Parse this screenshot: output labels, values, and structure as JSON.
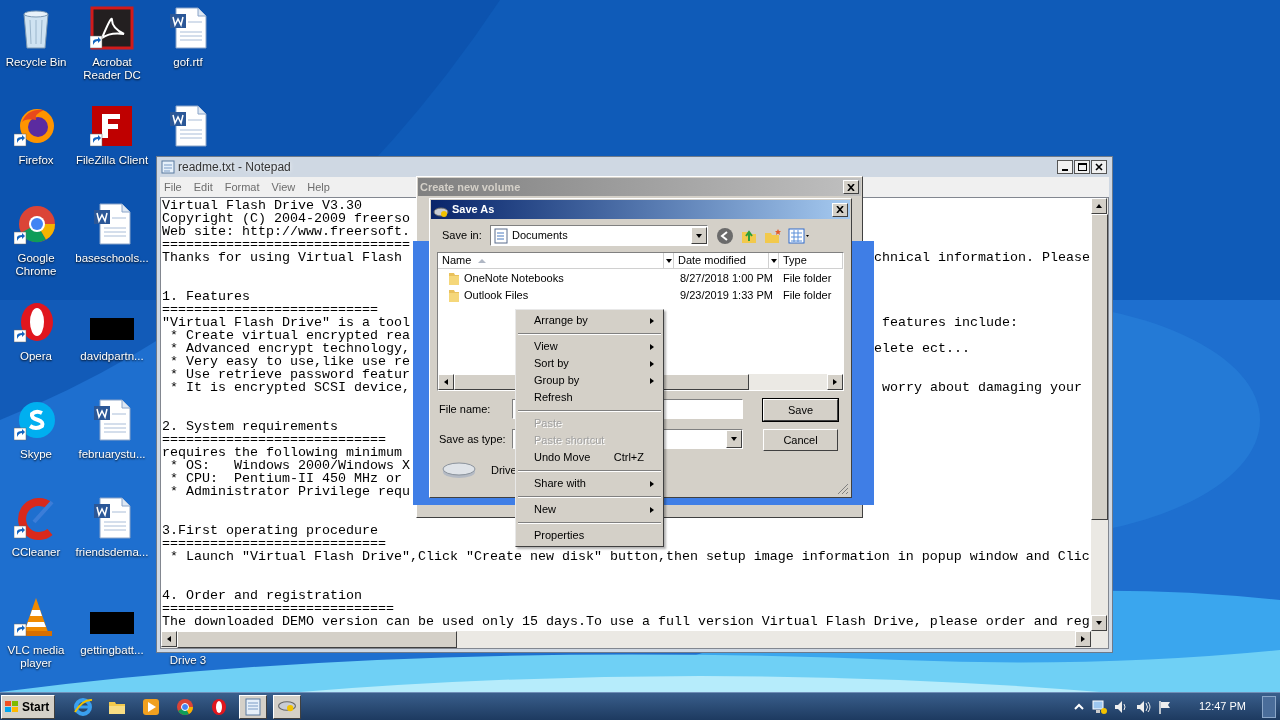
{
  "desktop_icons": [
    {
      "kind": "recycle",
      "label": "Recycle Bin"
    },
    {
      "kind": "firefox",
      "label": "Firefox"
    },
    {
      "kind": "chrome",
      "label": "Google Chrome"
    },
    {
      "kind": "opera",
      "label": "Opera"
    },
    {
      "kind": "skype",
      "label": "Skype"
    },
    {
      "kind": "ccleaner",
      "label": "CCleaner"
    },
    {
      "kind": "vlc",
      "label": "VLC media player"
    },
    {
      "kind": "acrobat",
      "label": "Acrobat Reader DC"
    },
    {
      "kind": "filezilla",
      "label": "FileZilla Client"
    },
    {
      "kind": "word",
      "label": "baseschools..."
    },
    {
      "kind": "redacted",
      "label": "davidpartn..."
    },
    {
      "kind": "word",
      "label": "februarystu..."
    },
    {
      "kind": "word",
      "label": "friendsdema..."
    },
    {
      "kind": "redacted",
      "label": "gettingbatt..."
    },
    {
      "kind": "word",
      "label": "gof.rtf"
    },
    {
      "kind": "word"
    },
    {
      "kind": "blank"
    },
    {
      "kind": "blank"
    },
    {
      "kind": "blank"
    },
    {
      "kind": "blank"
    },
    {
      "kind": "covered",
      "label": "Drive 3"
    }
  ],
  "notepad": {
    "title": "readme.txt - Notepad",
    "menu": [
      "File",
      "Edit",
      "Format",
      "View",
      "Help"
    ],
    "blocks": [
      [
        {
          "left": "Virtual Flash Drive V3.30"
        },
        {
          "left": "Copyright (C) 2004-2009 freerso"
        },
        {
          "left": "Web site: http://www.freersoft."
        },
        {
          "left": "==============================="
        },
        {
          "left": "Thanks for using Virtual Flash",
          "right": "chnical information. Please"
        }
      ],
      [
        {
          "left": "1. Features"
        },
        {
          "left": "==========================="
        },
        {
          "left": "\"Virtual Flash Drive\" is a tool",
          "right": " features include:"
        },
        {
          "left": " * Create virtual encrypted rea"
        },
        {
          "left": " * Advanced encrypt technology,",
          "right": "elete ect..."
        },
        {
          "left": " * Very easy to use,like use re"
        },
        {
          "left": " * Use retrieve password featur"
        },
        {
          "left": " * It is encrypted SCSI device,",
          "right": " worry about damaging your"
        }
      ],
      [
        {
          "left": "2. System requirements"
        },
        {
          "left": "============================"
        },
        {
          "left": "requires the following minimum"
        },
        {
          "left": " * OS:   Windows 2000/Windows X"
        },
        {
          "left": " * CPU:  Pentium-II 450 MHz or"
        },
        {
          "left": " * Administrator Privilege requ"
        }
      ],
      [
        {
          "left": "3.First operating procedure"
        },
        {
          "left": "============================"
        },
        {
          "left": " * Launch \"Virtual Flash Drive\",Click \"Create new disk\" button,then setup image information in popup window and Clic"
        }
      ],
      [
        {
          "left": "4. Order and registration"
        },
        {
          "left": "============================="
        },
        {
          "left": "The downloaded DEMO version can be used only 15 days.To use a full version Virtual Flash Drive, please order and reg"
        }
      ]
    ]
  },
  "volume_window": {
    "title": "Create new volume"
  },
  "save_as": {
    "title": "Save As",
    "save_in_label": "Save in:",
    "save_in": "Documents",
    "columns": [
      {
        "label": "Name",
        "sorted": true
      },
      {
        "label": "Date modified",
        "sorted": false
      },
      {
        "label": "Type",
        "sorted": false
      }
    ],
    "rows": [
      {
        "name": "OneNote Notebooks",
        "date": "8/27/2018 1:00 PM",
        "type": "File folder"
      },
      {
        "name": "Outlook Files",
        "date": "9/23/2019 1:33 PM",
        "type": "File folder"
      }
    ],
    "file_name_label": "File name:",
    "type_label": "Save as type:",
    "drive_label": "Drive",
    "buttons": [
      {
        "label": "Save",
        "default": true
      },
      {
        "label": "Cancel",
        "default": false
      }
    ]
  },
  "context_menu": [
    {
      "kind": "item",
      "label": "Arrange by",
      "submenu": true,
      "disabled": false
    },
    {
      "kind": "separator"
    },
    {
      "kind": "item",
      "label": "View",
      "submenu": true,
      "disabled": false
    },
    {
      "kind": "item",
      "label": "Sort by",
      "submenu": true,
      "disabled": false
    },
    {
      "kind": "item",
      "label": "Group by",
      "submenu": true,
      "disabled": false
    },
    {
      "kind": "item",
      "label": "Refresh",
      "submenu": false,
      "disabled": false
    },
    {
      "kind": "separator"
    },
    {
      "kind": "item",
      "label": "Paste",
      "submenu": false,
      "disabled": true
    },
    {
      "kind": "item",
      "label": "Paste shortcut",
      "submenu": false,
      "disabled": true
    },
    {
      "kind": "item",
      "label": "Undo Move",
      "shortcut": "Ctrl+Z",
      "submenu": false,
      "disabled": false
    },
    {
      "kind": "separator"
    },
    {
      "kind": "item",
      "label": "Share with",
      "submenu": true,
      "disabled": false
    },
    {
      "kind": "separator"
    },
    {
      "kind": "item",
      "label": "New",
      "submenu": true,
      "disabled": false
    },
    {
      "kind": "separator"
    },
    {
      "kind": "item",
      "label": "Properties",
      "submenu": false,
      "disabled": false
    }
  ],
  "taskbar": {
    "start": "Start",
    "items": [
      {
        "kind": "ie",
        "open": false
      },
      {
        "kind": "explorer",
        "open": false
      },
      {
        "kind": "media",
        "open": false
      },
      {
        "kind": "chrome",
        "open": false
      },
      {
        "kind": "opera",
        "open": false
      },
      {
        "kind": "notepad",
        "open": true
      },
      {
        "kind": "drive",
        "open": true
      }
    ],
    "tray": [
      {
        "kind": "chevron"
      },
      {
        "kind": "network"
      },
      {
        "kind": "volume"
      },
      {
        "kind": "speaker"
      },
      {
        "kind": "flag"
      }
    ],
    "clock": "12:47 PM"
  }
}
